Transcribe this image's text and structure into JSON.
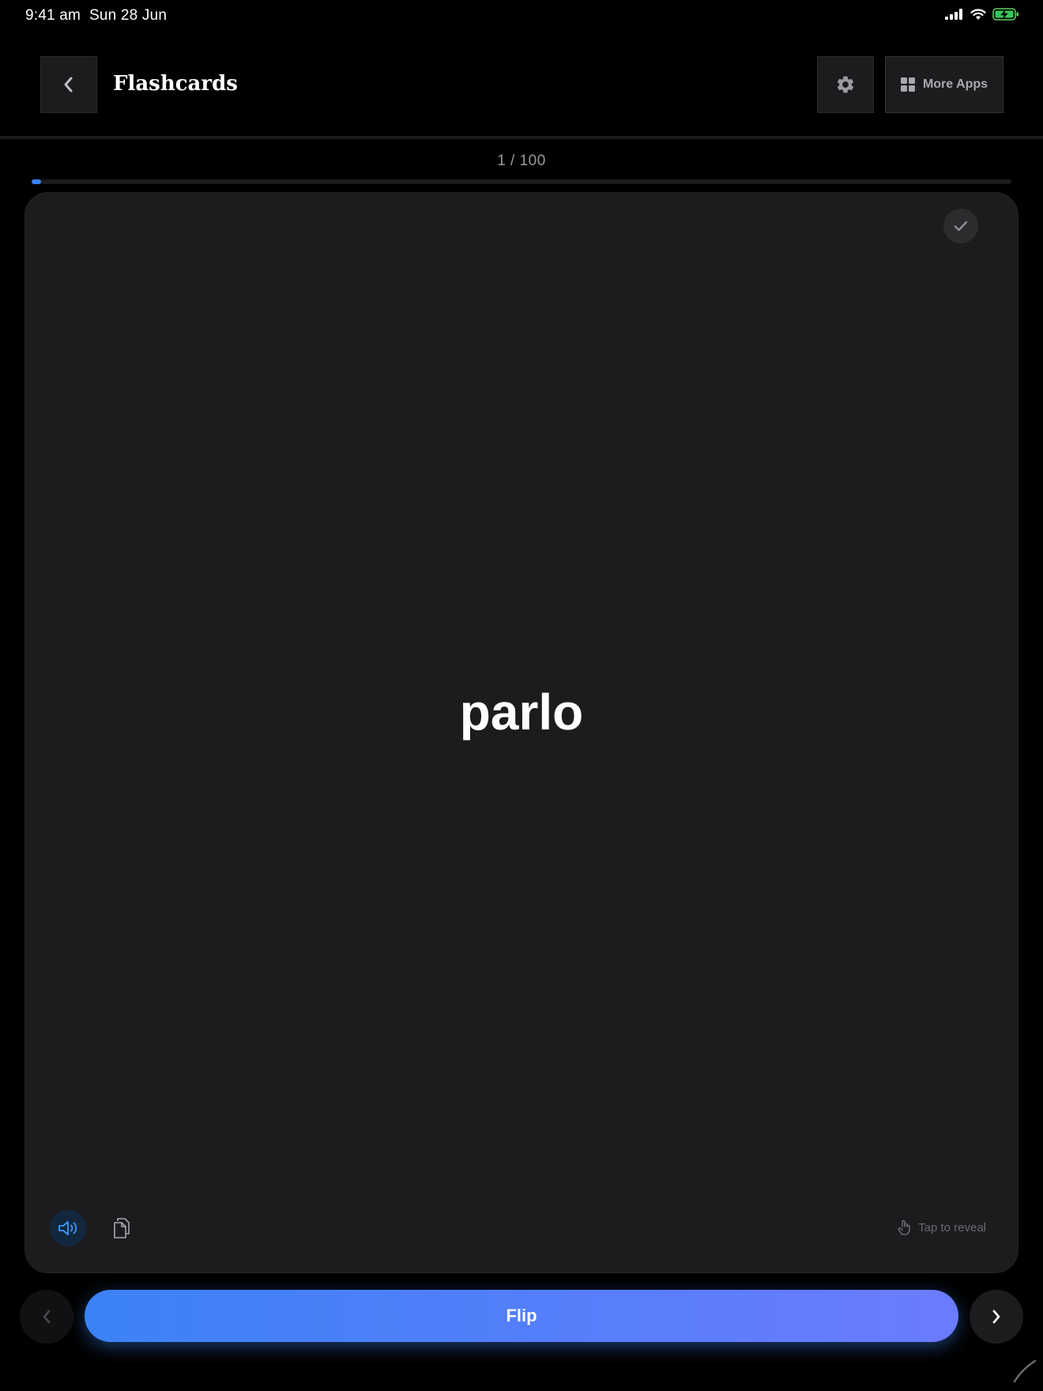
{
  "status_bar": {
    "time": "9:41 am",
    "date": "Sun 28 Jun",
    "icons": [
      "cellular-signal-icon",
      "wifi-icon",
      "battery-charging-icon"
    ]
  },
  "header": {
    "title": "Flashcards",
    "back_icon": "chevron-left-icon",
    "settings_icon": "gear-icon",
    "more_apps_label": "More Apps",
    "more_apps_icon": "grid-icon"
  },
  "progress": {
    "counter_text": "1 / 100",
    "current": 1,
    "total": 100,
    "fraction": 0.01,
    "accent_color": "#3b82f6"
  },
  "card": {
    "word": "parlo",
    "known_icon": "checkmark-icon",
    "audio_icon": "speaker-icon",
    "copy_icon": "copy-icon",
    "hint_icon": "tap-hand-icon",
    "hint_text": "Tap to reveal"
  },
  "footer": {
    "prev_icon": "chevron-left-icon",
    "flip_label": "Flip",
    "next_icon": "chevron-right-icon",
    "flip_gradient": [
      "#3b82f6",
      "#6b7bff"
    ]
  }
}
